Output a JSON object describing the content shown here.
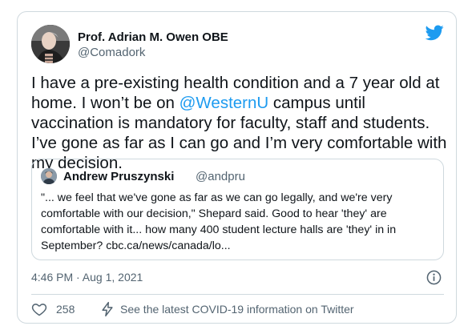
{
  "author": {
    "display_name": "Prof. Adrian M. Owen OBE",
    "handle": "@Comadork"
  },
  "tweet": {
    "text_1": "I have a pre-existing health condition and a 7 year old at home. I won’t be on ",
    "mention": "@WesternU",
    "text_2": " campus until vaccination is mandatory for faculty, staff and students. I’ve gone as far as I can go and I’m very comfortable with my decision."
  },
  "quote": {
    "display_name": "Andrew Pruszynski",
    "handle": "@andpru",
    "text": "\"... we feel that we've gone as far as we can go legally, and we're very comfortable with our decision,\" Shepard said. Good to hear 'they' are comfortable with it... how many 400 student lecture halls are 'they' in in September?  cbc.ca/news/canada/lo..."
  },
  "meta": {
    "timestamp": "4:46 PM · Aug 1, 2021"
  },
  "actions": {
    "like_count": "258",
    "covid_label": "See the latest COVID-19 information on Twitter"
  },
  "icons": {
    "bird": "twitter-bird-icon",
    "info": "info-icon",
    "like": "heart-icon",
    "bolt": "lightning-bolt-icon"
  },
  "colors": {
    "accent": "#1d9bf0",
    "text": "#0f1419",
    "secondary": "#536471",
    "border": "#cfd9de"
  }
}
